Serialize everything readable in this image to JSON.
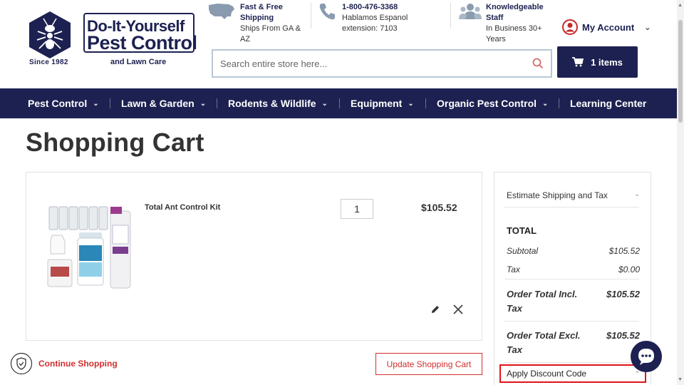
{
  "logo": {
    "line1": "Do-It-Yourself",
    "line2": "Pest Control",
    "line3": "and Lawn Care",
    "since": "Since 1982"
  },
  "header_info": {
    "shipping": {
      "title": "Fast & Free Shipping",
      "text": "Ships From GA & AZ"
    },
    "phone": {
      "title": "1-800-476-3368",
      "text": "Hablamos Espanol extension: 7103"
    },
    "staff": {
      "title": "Knowledgeable Staff",
      "text": "In Business 30+ Years"
    }
  },
  "account": {
    "label": "My Account"
  },
  "search": {
    "placeholder": "Search entire store here..."
  },
  "cart_button": {
    "label": "1 items"
  },
  "nav": {
    "items": [
      {
        "label": "Pest Control"
      },
      {
        "label": "Lawn & Garden"
      },
      {
        "label": "Rodents & Wildlife"
      },
      {
        "label": "Equipment"
      },
      {
        "label": "Organic Pest Control"
      },
      {
        "label": "Learning Center"
      }
    ]
  },
  "page": {
    "title": "Shopping Cart"
  },
  "cart": {
    "items": [
      {
        "name": "Total Ant Control Kit",
        "qty": "1",
        "price": "$105.52"
      }
    ],
    "continue_label": "Continue Shopping",
    "update_label": "Update Shopping Cart"
  },
  "summary": {
    "estimate_label": "Estimate Shipping and Tax",
    "total_heading": "TOTAL",
    "subtotal_label": "Subtotal",
    "subtotal_value": "$105.52",
    "tax_label": "Tax",
    "tax_value": "$0.00",
    "incl_label": "Order Total Incl. Tax",
    "incl_value": "$105.52",
    "excl_label": "Order Total Excl. Tax",
    "excl_value": "$105.52",
    "discount_label": "Apply Discount Code"
  },
  "colors": {
    "navy": "#1d2151",
    "accent_red": "#d22e2e",
    "highlight_red": "#e0141a"
  }
}
